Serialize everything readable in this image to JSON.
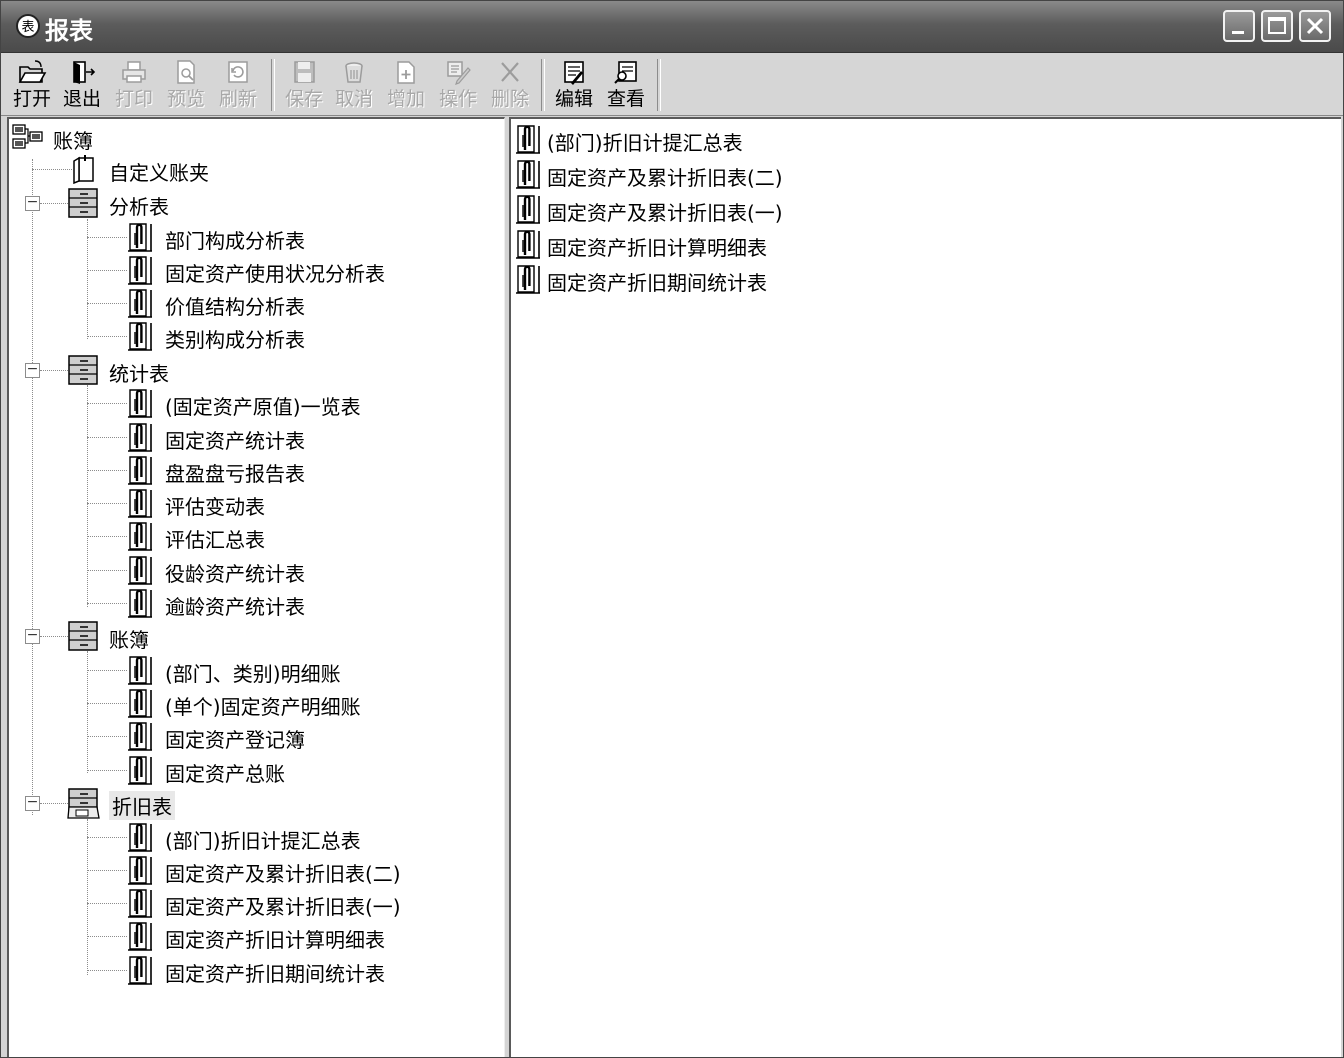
{
  "window": {
    "title": "报表"
  },
  "toolbar": {
    "items": [
      {
        "label": "打开",
        "icon": "open-folder-icon",
        "enabled": true
      },
      {
        "label": "退出",
        "icon": "exit-door-icon",
        "enabled": true
      },
      {
        "label": "打印",
        "icon": "printer-icon",
        "enabled": false
      },
      {
        "label": "预览",
        "icon": "print-preview-icon",
        "enabled": false
      },
      {
        "label": "刷新",
        "icon": "refresh-icon",
        "enabled": false
      },
      {
        "label": "保存",
        "icon": "save-disk-icon",
        "enabled": false
      },
      {
        "label": "取消",
        "icon": "cancel-bucket-icon",
        "enabled": false
      },
      {
        "label": "增加",
        "icon": "add-document-icon",
        "enabled": false
      },
      {
        "label": "操作",
        "icon": "operate-pencil-icon",
        "enabled": false
      },
      {
        "label": "删除",
        "icon": "delete-x-icon",
        "enabled": false
      },
      {
        "label": "编辑",
        "icon": "edit-report-icon",
        "enabled": true
      },
      {
        "label": "查看",
        "icon": "view-report-icon",
        "enabled": true
      }
    ]
  },
  "tree": {
    "root": "账簿",
    "custom_folder": "自定义账夹",
    "groups": [
      {
        "label": "分析表",
        "selected": false,
        "items": [
          "部门构成分析表",
          "固定资产使用状况分析表",
          "价值结构分析表",
          "类别构成分析表"
        ]
      },
      {
        "label": "统计表",
        "selected": false,
        "items": [
          "(固定资产原值)一览表",
          "固定资产统计表",
          "盘盈盘亏报告表",
          "评估变动表",
          "评估汇总表",
          "役龄资产统计表",
          "逾龄资产统计表"
        ]
      },
      {
        "label": "账簿",
        "selected": false,
        "items": [
          "(部门、类别)明细账",
          "(单个)固定资产明细账",
          "固定资产登记簿",
          "固定资产总账"
        ]
      },
      {
        "label": "折旧表",
        "selected": true,
        "items": [
          "(部门)折旧计提汇总表",
          "固定资产及累计折旧表(二)",
          "固定资产及累计折旧表(一)",
          "固定资产折旧计算明细表",
          "固定资产折旧期间统计表"
        ]
      }
    ]
  },
  "report_list": {
    "items": [
      "(部门)折旧计提汇总表",
      "固定资产及累计折旧表(二)",
      "固定资产及累计折旧表(一)",
      "固定资产折旧计算明细表",
      "固定资产折旧期间统计表"
    ]
  }
}
